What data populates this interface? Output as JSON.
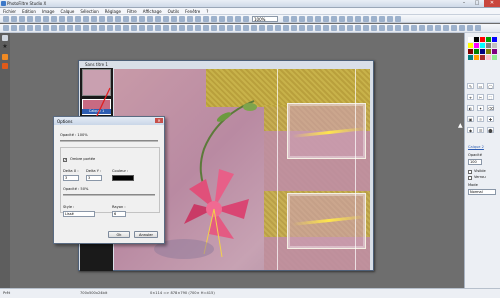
{
  "app": {
    "title": "PhotoFiltre Studio X",
    "controls": {
      "minimize": "–",
      "maximize": "□",
      "close": "✕"
    }
  },
  "menu": {
    "items": [
      "Fichier",
      "Edition",
      "Image",
      "Calque",
      "Sélection",
      "Réglage",
      "Filtre",
      "Affichage",
      "Outils",
      "Fenêtre",
      "?"
    ]
  },
  "toolbar": {
    "zoom_value": "100%"
  },
  "document": {
    "title": "Sans titre 1",
    "layer_label": "Calque 1"
  },
  "dialog": {
    "title": "Options",
    "close": "✕",
    "opacity1_label": "Opacité : 100%",
    "ombre_label": "Ombre portée",
    "ombre_checked": "✓",
    "deltax_label": "Delta X :",
    "deltax_value": "3",
    "deltay_label": "Delta Y :",
    "deltay_value": "3",
    "couleur_label": "Couleur :",
    "opacity2_label": "Opacité : 50%",
    "style_label": "Style :",
    "style_value": "Lissé",
    "rayon_label": "Rayon :",
    "rayon_value": "6",
    "ok_label": "Ok",
    "cancel_label": "Annuler",
    "shadow_color": "#000000"
  },
  "right_panel": {
    "layer_name": "Calque 2",
    "opacity_label": "Opacité",
    "opacity_value": "100",
    "visible_label": "Visible",
    "locked_label": "Verrou",
    "mode_label": "Mode",
    "mode_value": "Normal",
    "palette": [
      "#ffffff",
      "#000000",
      "#ff0000",
      "#00a000",
      "#0000ff",
      "#ffff00",
      "#ff00ff",
      "#00ffff",
      "#808080",
      "#c0c0c0",
      "#800000",
      "#008000",
      "#000080",
      "#808000",
      "#800080",
      "#008080",
      "#ffa500",
      "#a52a2a",
      "#ffc0cb",
      "#90ee90"
    ]
  },
  "status": {
    "ready": "Prêt",
    "size": "700x500x24bit",
    "coords": "0×114 => 878×790 (700× H=415)"
  },
  "colors": {
    "accent": "#2d5db3",
    "arrow": "#e02020"
  }
}
